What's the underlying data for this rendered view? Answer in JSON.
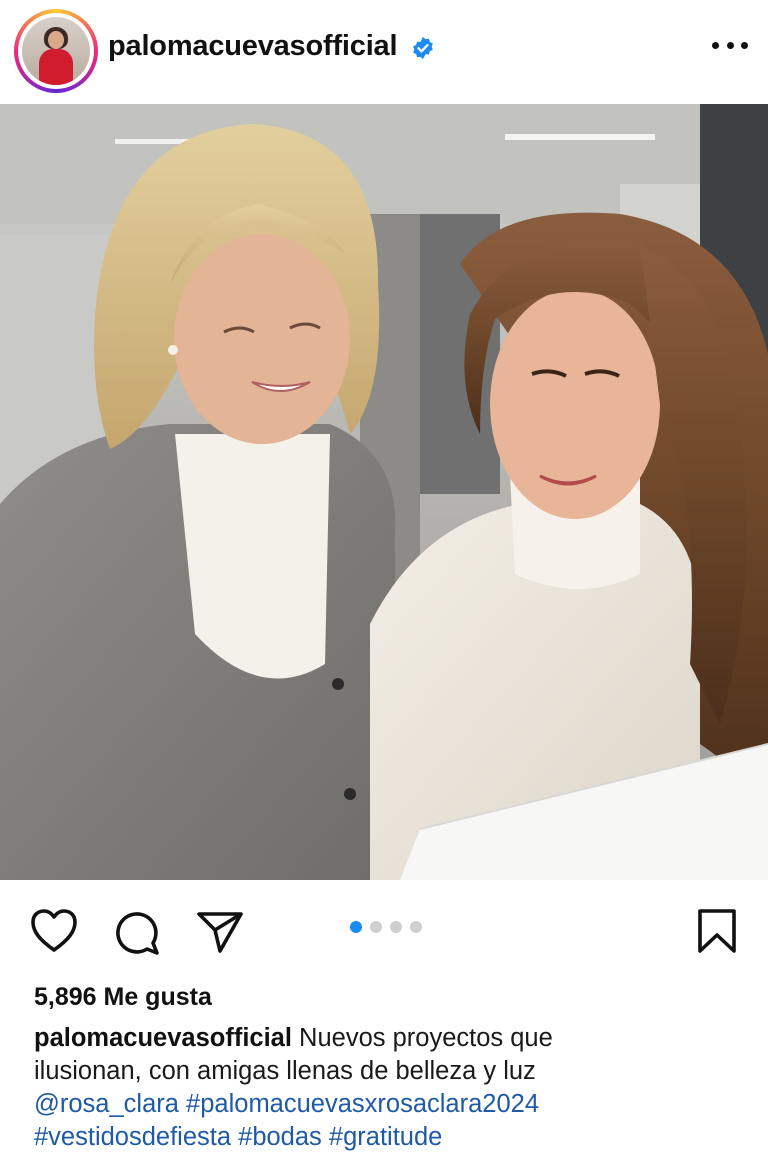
{
  "post": {
    "username": "palomacuevasofficial",
    "verified_icon": "verified-badge-icon",
    "more_icon": "more-options-icon",
    "likes_text": "5,896 Me gusta",
    "carousel": {
      "count": 4,
      "active": 0
    },
    "caption": {
      "username": "palomacuevasofficial",
      "text_line1": " Nuevos proyectos que",
      "text_line2": "ilusionan, con amigas llenas de belleza y luz",
      "mention": "@rosa_clara",
      "hashtag1": "#palomacuevasxrosaclara2024",
      "hashtag2": "#vestidosdefiesta",
      "hashtag3": "#bodas",
      "hashtag4": "#gratitude"
    }
  },
  "colors": {
    "link": "#1f5aa6",
    "verified": "#1a8cf0",
    "carousel_active": "#1a8cf0",
    "carousel_inactive": "#cfcfcf"
  }
}
